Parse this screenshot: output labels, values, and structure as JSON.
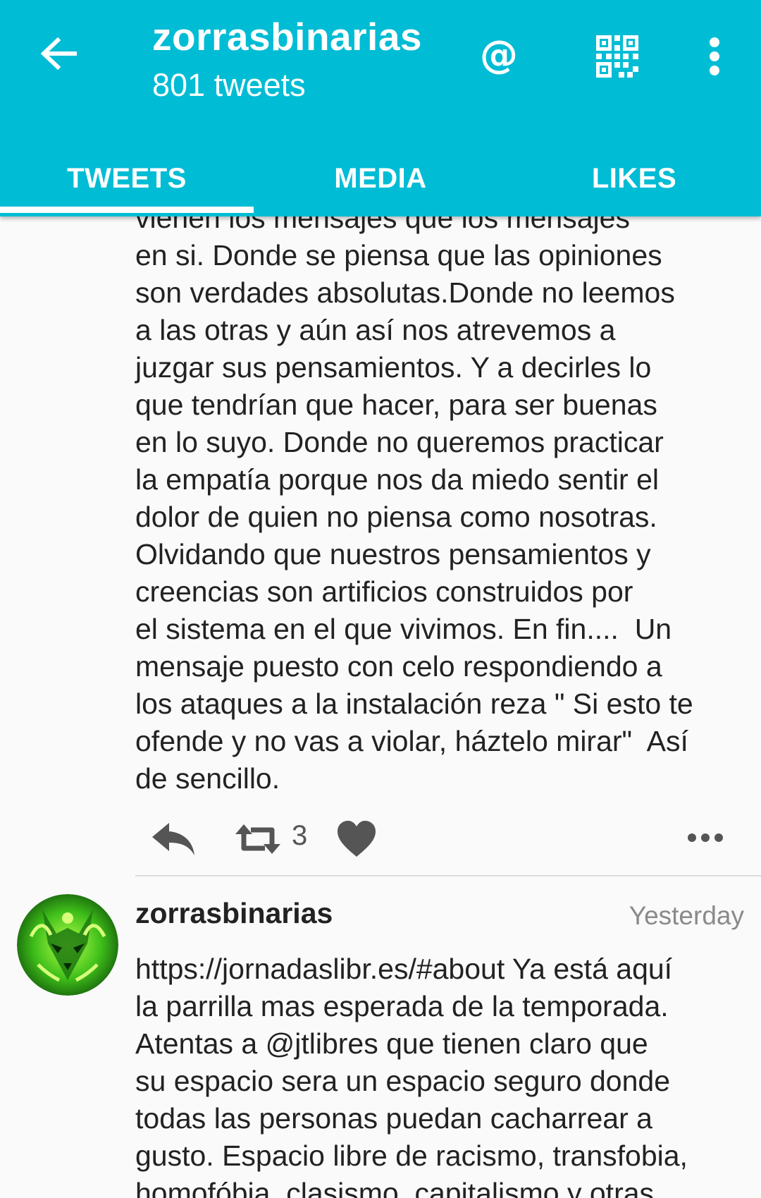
{
  "header": {
    "title": "zorrasbinarias",
    "subtitle": "801 tweets",
    "back_icon": "arrow-back-icon",
    "mention_icon": "at-icon",
    "mention_label": "@",
    "qr_icon": "qr-code-icon",
    "overflow_icon": "more-vert-icon"
  },
  "tabs": [
    {
      "label": "TWEETS",
      "selected": true
    },
    {
      "label": "MEDIA",
      "selected": false
    },
    {
      "label": "LIKES",
      "selected": false
    }
  ],
  "tweets": [
    {
      "text": "vienen los mensajes que los mensajes\nen si. Donde se piensa que las opiniones\nson verdades absolutas.Donde no leemos\na las otras y aún así nos atrevemos a\njuzgar sus pensamientos. Y a decirles lo\nque tendrían que hacer, para ser buenas\nen lo suyo. Donde no queremos practicar\nla empatía porque nos da miedo sentir el\ndolor de quien no piensa como nosotras.\nOlvidando que nuestros pensamientos y\ncreencias son artificios construidos por\nel sistema en el que vivimos. En fin....  Un\nmensaje puesto con celo respondiendo a\nlos ataques a la instalación reza \" Si esto te\nofende y no vas a violar, háztelo mirar\"  Así\nde sencillo.",
      "retweet_count": "3",
      "icons": {
        "reply": "reply-icon",
        "retweet": "retweet-icon",
        "like": "heart-icon",
        "more": "more-horiz-icon"
      }
    },
    {
      "user": "zorrasbinarias",
      "time": "Yesterday",
      "text": "https://jornadaslibr.es/#about Ya está aquí\nla parrilla mas esperada de la temporada.\nAtentas a @jtlibres que tienen claro que\nsu espacio sera un espacio seguro donde\ntodas las personas puedan cacharrear a\ngusto. Espacio libre de racismo, transfobia,\nhomofóbia, clasismo, capitalismo y otras",
      "avatar": "green-fox-avatar"
    }
  ],
  "colors": {
    "appbar": "#00bcd4",
    "text": "#222222",
    "muted": "#8a8a8a",
    "icon": "#555555"
  }
}
